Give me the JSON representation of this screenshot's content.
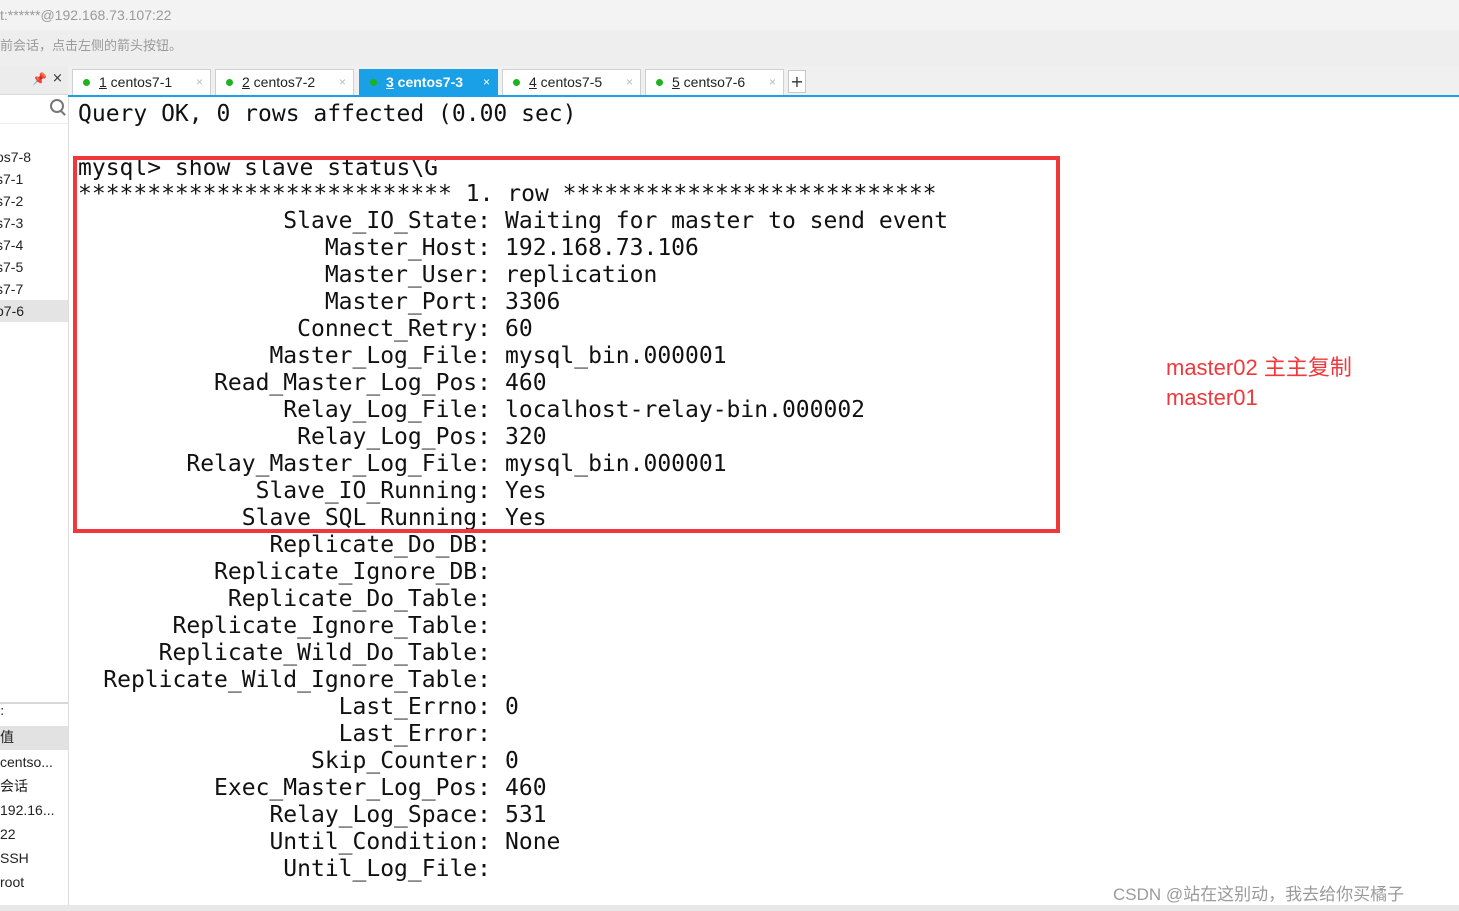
{
  "window": {
    "title": "t:******@192.168.73.107:22",
    "hint": "前会话，点击左侧的箭头按钮。"
  },
  "sidebar": {
    "pin_glyph": "📌",
    "close_glyph": "×",
    "sessions": [
      "os7-8",
      "s7-1",
      "s7-2",
      "s7-3",
      "s7-4",
      "s7-5",
      "s7-7",
      "o7-6"
    ],
    "active_session_index": 7,
    "properties": {
      "header": ":",
      "value_col": "值",
      "rows": [
        "centso...",
        "会话",
        "192.16...",
        "22",
        "SSH",
        "root"
      ]
    }
  },
  "tabs": [
    {
      "num": "1",
      "label": " centos7-1",
      "active": false
    },
    {
      "num": "2",
      "label": " centos7-2",
      "active": false
    },
    {
      "num": "3",
      "label": " centos7-3",
      "active": true
    },
    {
      "num": "4",
      "label": " centos7-5",
      "active": false
    },
    {
      "num": "5",
      "label": " centso7-6",
      "active": false
    }
  ],
  "tab_close_glyph": "×",
  "add_tab_glyph": "+",
  "terminal": {
    "query_ok": "Query OK, 0 rows affected (0.00 sec)",
    "command": "mysql> show slave status\\G",
    "row_header": "*************************** 1. row ***************************",
    "fields": [
      {
        "name": "Slave_IO_State:",
        "value": "Waiting for master to send event"
      },
      {
        "name": "Master_Host:",
        "value": "192.168.73.106"
      },
      {
        "name": "Master_User:",
        "value": "replication"
      },
      {
        "name": "Master_Port:",
        "value": "3306"
      },
      {
        "name": "Connect_Retry:",
        "value": "60"
      },
      {
        "name": "Master_Log_File:",
        "value": "mysql_bin.000001"
      },
      {
        "name": "Read_Master_Log_Pos:",
        "value": "460"
      },
      {
        "name": "Relay_Log_File:",
        "value": "localhost-relay-bin.000002"
      },
      {
        "name": "Relay_Log_Pos:",
        "value": "320"
      },
      {
        "name": "Relay_Master_Log_File:",
        "value": "mysql_bin.000001"
      },
      {
        "name": "Slave_IO_Running:",
        "value": "Yes"
      },
      {
        "name": "Slave_SQL_Running:",
        "value": "Yes"
      },
      {
        "name": "Replicate_Do_DB:",
        "value": ""
      },
      {
        "name": "Replicate_Ignore_DB:",
        "value": ""
      },
      {
        "name": "Replicate_Do_Table:",
        "value": ""
      },
      {
        "name": "Replicate_Ignore_Table:",
        "value": ""
      },
      {
        "name": "Replicate_Wild_Do_Table:",
        "value": ""
      },
      {
        "name": "Replicate_Wild_Ignore_Table:",
        "value": ""
      },
      {
        "name": "Last_Errno:",
        "value": "0"
      },
      {
        "name": "Last_Error:",
        "value": ""
      },
      {
        "name": "Skip_Counter:",
        "value": "0"
      },
      {
        "name": "Exec_Master_Log_Pos:",
        "value": "460"
      },
      {
        "name": "Relay_Log_Space:",
        "value": "531"
      },
      {
        "name": "Until_Condition:",
        "value": "None"
      },
      {
        "name": "Until_Log_File:",
        "value": ""
      }
    ]
  },
  "annotation": {
    "line1": "master02  主主复制",
    "line2": "master01"
  },
  "watermark": "CSDN @站在这别动，我去给你买橘子",
  "colors": {
    "tab_active": "#1aa0e6",
    "status_dot": "#1db31d",
    "highlight": "#f0383c"
  }
}
